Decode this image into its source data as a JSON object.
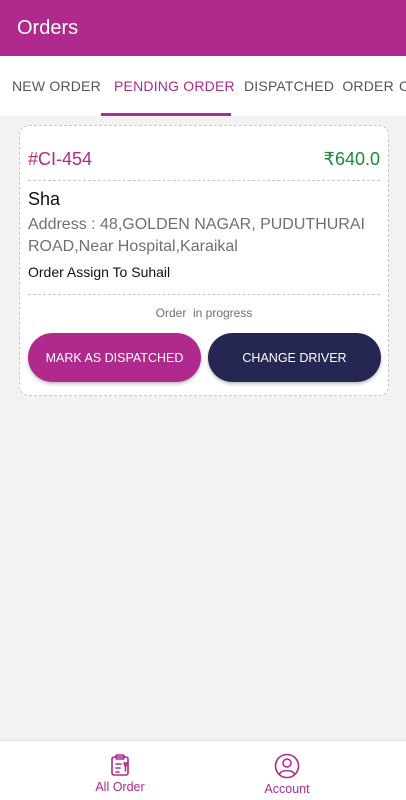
{
  "app": {
    "title": "Orders"
  },
  "tabs": [
    {
      "label": "NEW ORDER",
      "active": false
    },
    {
      "label": "PENDING ORDER",
      "active": true
    },
    {
      "label": "DISPATCHED  ORDER",
      "active": false
    },
    {
      "label": "C",
      "active": false
    }
  ],
  "order": {
    "id": "#CI-454",
    "amount": "₹640.0",
    "customer": "Sha",
    "address": "Address : 48,GOLDEN NAGAR, PUDUTHURAI ROAD,Near Hospital,Karaikal",
    "assignment": "Order Assign To Suhail",
    "status": "Order  in progress",
    "dispatch_label": "MARK AS DISPATCHED",
    "change_driver_label": "CHANGE DRIVER"
  },
  "bottom_nav": [
    {
      "label": "All Order",
      "icon": "clipboard-icon"
    },
    {
      "label": "Account",
      "icon": "account-icon"
    }
  ],
  "colors": {
    "primary": "#b02a8e",
    "dark_button": "#262653",
    "amount_green": "#1e8a3c",
    "background": "#f2f2f2"
  }
}
